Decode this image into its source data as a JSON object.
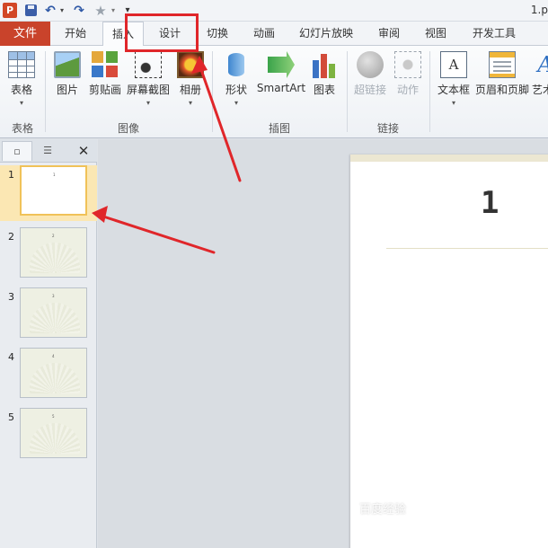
{
  "titlebar": {
    "app_icon": "powerpoint-icon",
    "app_letter": "P",
    "quick_access": [
      "save-icon",
      "undo-icon",
      "redo-icon",
      "star-icon",
      "customize-icon"
    ],
    "undo_glyph": "↶",
    "redo_glyph": "↷",
    "star_glyph": "★",
    "dropdown_glyph": "▾",
    "customize_glyph": "▾",
    "title": "1.p"
  },
  "tabs": {
    "file": "文件",
    "items": [
      {
        "label": "开始"
      },
      {
        "label": "插入",
        "active": true
      },
      {
        "label": "设计"
      },
      {
        "label": "切换"
      },
      {
        "label": "动画"
      },
      {
        "label": "幻灯片放映"
      },
      {
        "label": "审阅"
      },
      {
        "label": "视图"
      },
      {
        "label": "开发工具"
      }
    ]
  },
  "ribbon": {
    "buttons": {
      "table": "表格",
      "picture": "图片",
      "clipart": "剪贴画",
      "screenshot": "屏幕截图",
      "album": "相册",
      "shapes": "形状",
      "smartart": "SmartArt",
      "chart": "图表",
      "hyperlink": "超链接",
      "action": "动作",
      "textbox": "文本框",
      "header_footer": "页眉和页脚",
      "wordart": "艺术"
    },
    "groups": {
      "tables": "表格",
      "images": "图像",
      "illustrations": "插图",
      "links": "链接"
    },
    "textbox_glyph": "A",
    "wordart_glyph": "A",
    "dropdown_glyph": "▾",
    "screenshot_plus": "+"
  },
  "panel": {
    "slides_tab_icon": "slides-icon",
    "outline_tab_icon": "outline-icon",
    "slides_glyph": "▫",
    "outline_glyph": "☰",
    "close_glyph": "✕",
    "thumbnails": [
      {
        "number": "1",
        "selected": true
      },
      {
        "number": "2"
      },
      {
        "number": "3"
      },
      {
        "number": "4"
      },
      {
        "number": "5"
      }
    ]
  },
  "slide": {
    "title_number": "1"
  },
  "watermark": "百度经验",
  "colors": {
    "accent_file_tab": "#c9432b",
    "annotation_red": "#e0262a",
    "selected_thumb": "#f0c258"
  }
}
